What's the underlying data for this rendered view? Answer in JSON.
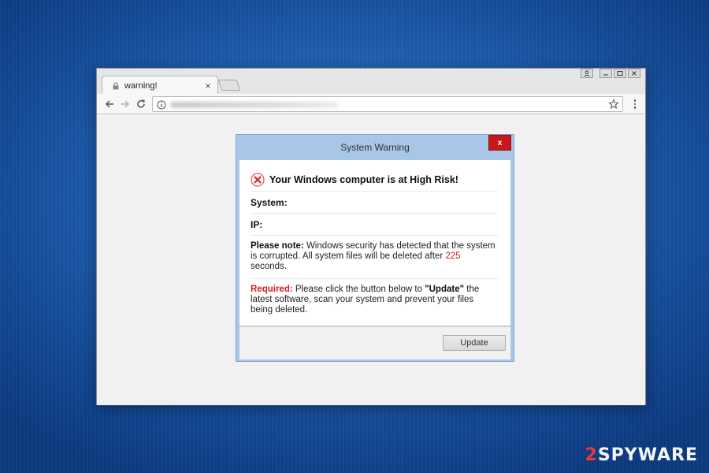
{
  "browser": {
    "tab_title": "warning!",
    "tab_close": "×"
  },
  "dialog": {
    "title": "System Warning",
    "close_label": "x",
    "risk_heading": "Your Windows computer is at High Risk!",
    "system_label": "System:",
    "ip_label": "IP:",
    "note_label": "Please note:",
    "note_text_1": " Windows security has detected that the system is corrupted. All system files will be deleted after ",
    "note_seconds": "225",
    "note_text_2": " seconds.",
    "required_label": "Required:",
    "required_text_1": " Please click the button below to ",
    "required_update": "\"Update\"",
    "required_text_2": " the latest software, scan your system and prevent your files being deleted.",
    "update_button": "Update"
  },
  "watermark": {
    "two": "2",
    "rest": "SPYWAR",
    "end": "E"
  },
  "colors": {
    "alert_red": "#d01f24",
    "dialog_blue": "#a8c6e7",
    "close_red": "#c8181c"
  },
  "icons": [
    "lock-icon",
    "back-arrow-icon",
    "forward-arrow-icon",
    "reload-icon",
    "info-icon",
    "star-icon",
    "menu-dots-icon",
    "error-x-icon"
  ]
}
